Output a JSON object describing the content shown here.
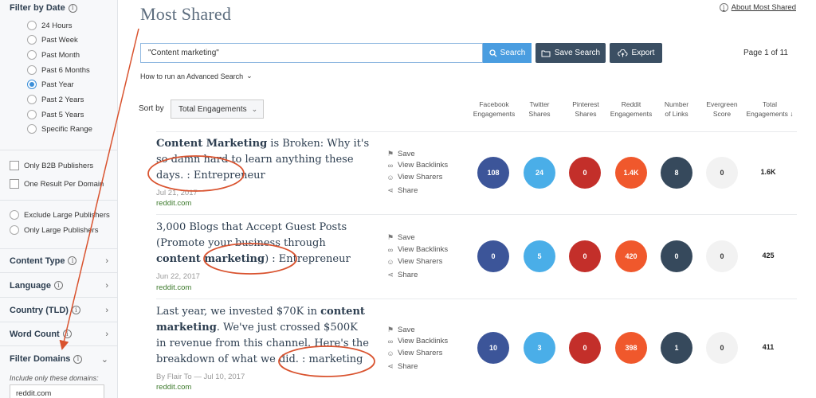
{
  "sidebar": {
    "filter_by_date": "Filter by Date",
    "date_options": [
      {
        "label": "24 Hours",
        "selected": false
      },
      {
        "label": "Past Week",
        "selected": false
      },
      {
        "label": "Past Month",
        "selected": false
      },
      {
        "label": "Past 6 Months",
        "selected": false
      },
      {
        "label": "Past Year",
        "selected": true
      },
      {
        "label": "Past 2 Years",
        "selected": false
      },
      {
        "label": "Past 5 Years",
        "selected": false
      },
      {
        "label": "Specific Range",
        "selected": false
      }
    ],
    "checkboxes": [
      "Only B2B Publishers",
      "One Result Per Domain"
    ],
    "publisher_options": [
      "Exclude Large Publishers",
      "Only Large Publishers"
    ],
    "sections": [
      "Content Type",
      "Language",
      "Country (TLD)",
      "Word Count"
    ],
    "filter_domains": "Filter Domains",
    "include_domains_label": "Include only these domains:",
    "domain_value": "reddit.com"
  },
  "header": {
    "title": "Most Shared",
    "about_link": "About Most Shared",
    "search_value": "\"Content marketing\"",
    "search_button": "Search",
    "save_search_button": "Save Search",
    "export_button": "Export",
    "page_count": "Page 1 of 11",
    "advanced_search": "How to run an Advanced Search",
    "sort_label": "Sort by",
    "sort_value": "Total Engagements"
  },
  "columns": [
    {
      "line1": "Facebook",
      "line2": "Engagements"
    },
    {
      "line1": "Twitter",
      "line2": "Shares"
    },
    {
      "line1": "Pinterest",
      "line2": "Shares"
    },
    {
      "line1": "Reddit",
      "line2": "Engagements"
    },
    {
      "line1": "Number",
      "line2": "of Links"
    },
    {
      "line1": "Evergreen",
      "line2": "Score"
    },
    {
      "line1": "Total",
      "line2": "Engagements ↓"
    }
  ],
  "actions": [
    "Save",
    "View Backlinks",
    "View Sharers",
    "Share"
  ],
  "results": [
    {
      "title_bold": "Content Marketing",
      "title_rest": " is Broken: Why it's so damn hard to learn anything these days. : Entrepreneur",
      "meta": "Jul 21, 2017",
      "domain": "reddit.com",
      "facebook": "108",
      "twitter": "24",
      "pinterest": "0",
      "reddit": "1.4K",
      "links": "8",
      "evergreen": "0",
      "total": "1.6K"
    },
    {
      "title_pre": "3,000 Blogs that Accept Guest Posts (Promote your business through ",
      "title_bold": "content marketing",
      "title_rest": ") : Entrepreneur",
      "meta": "Jun 22, 2017",
      "domain": "reddit.com",
      "facebook": "0",
      "twitter": "5",
      "pinterest": "0",
      "reddit": "420",
      "links": "0",
      "evergreen": "0",
      "total": "425"
    },
    {
      "title_pre": "Last year, we invested $70K in ",
      "title_bold": "content marketing",
      "title_rest": ". We've just crossed $500K in revenue from this channel. Here's the breakdown of what we did. : marketing",
      "meta": "By Flair To — Jul 10, 2017",
      "domain": "reddit.com",
      "facebook": "10",
      "twitter": "3",
      "pinterest": "0",
      "reddit": "398",
      "links": "1",
      "evergreen": "0",
      "total": "411"
    }
  ],
  "colors": {
    "facebook": "#3c5599",
    "twitter": "#4aaee8",
    "pinterest": "#c32f2a",
    "reddit": "#f0582c",
    "links": "#36495c",
    "evergreen": "#f2f2f2",
    "annotation": "#d9532f",
    "search_button": "#4a9de0",
    "dark_button": "#3b4f63"
  }
}
